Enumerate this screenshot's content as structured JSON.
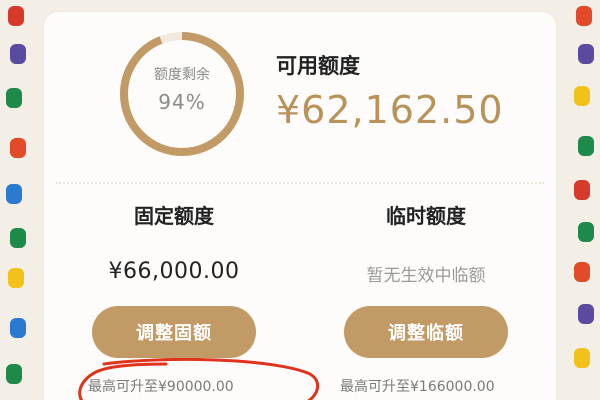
{
  "remaining": {
    "label": "额度剩余",
    "percent_text": "94%",
    "fraction": 0.94
  },
  "available": {
    "title": "可用额度",
    "amount": "¥62,162.50"
  },
  "fixed": {
    "title": "固定额度",
    "amount": "¥66,000.00",
    "button_label": "调整固额",
    "max_note": "最高可升至¥90000.00"
  },
  "temporary": {
    "title": "临时额度",
    "status": "暂无生效中临额",
    "button_label": "调整临额",
    "max_note": "最高可升至¥166000.00"
  },
  "colors": {
    "accent": "#c19a66",
    "ring_track": "#f1e9dd",
    "annotation": "#e0321c"
  }
}
